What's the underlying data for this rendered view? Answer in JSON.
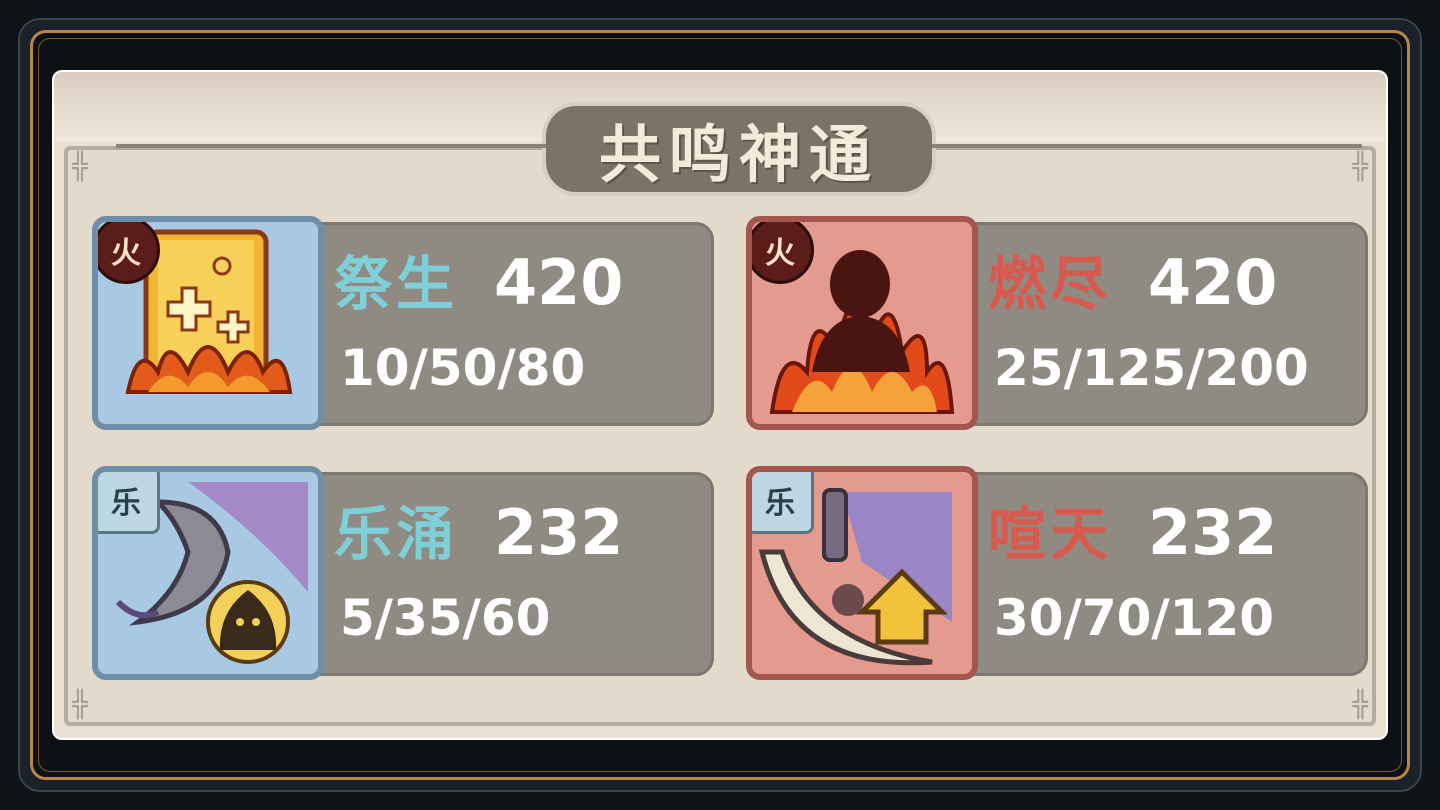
{
  "window": {
    "title": "共鸣神通"
  },
  "corner_glyph": "╬",
  "skills": [
    {
      "element_badge": "火",
      "name": "祭生",
      "value": "420",
      "stages": "10/50/80",
      "icon": "fire-scroll-icon",
      "theme": "blue"
    },
    {
      "element_badge": "火",
      "name": "燃尽",
      "value": "420",
      "stages": "25/125/200",
      "icon": "burning-figure-icon",
      "theme": "red"
    },
    {
      "element_badge": "乐",
      "name": "乐涌",
      "value": "232",
      "stages": "5/35/60",
      "icon": "horn-icon",
      "theme": "blue"
    },
    {
      "element_badge": "乐",
      "name": "喧天",
      "value": "232",
      "stages": "30/70/120",
      "icon": "cymbal-upgrade-icon",
      "theme": "red"
    }
  ],
  "colors": {
    "name_blue_theme": "#7fcfd8",
    "name_red_theme": "#d85a4f",
    "frame_gold": "#b8864b"
  }
}
